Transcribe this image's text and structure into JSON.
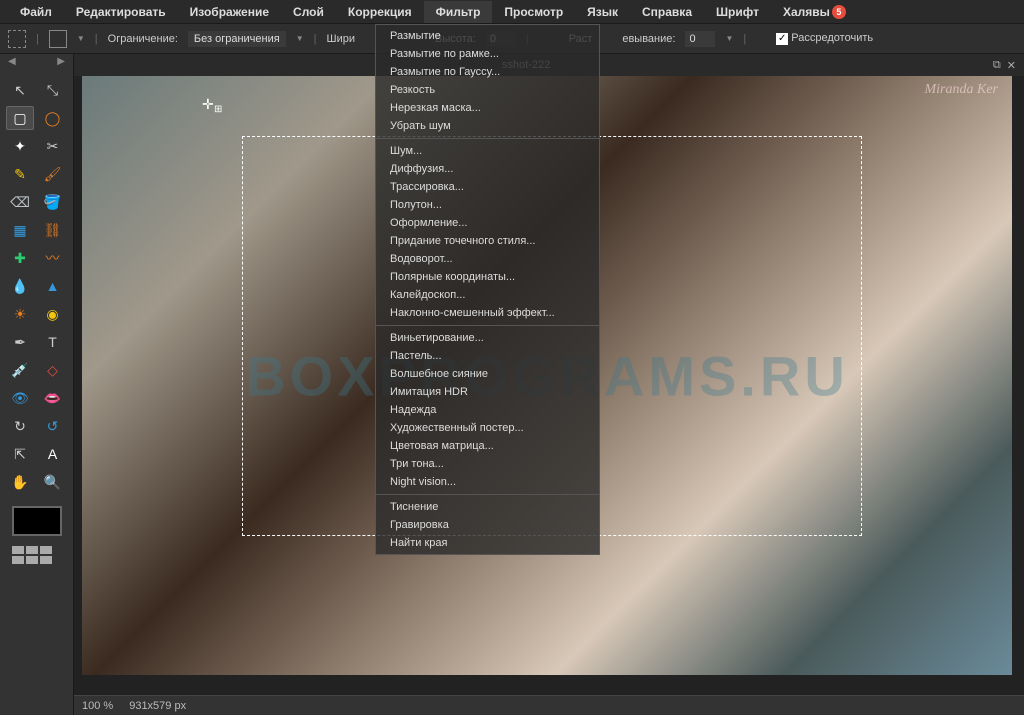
{
  "menubar": [
    "Файл",
    "Редактировать",
    "Изображение",
    "Слой",
    "Коррекция",
    "Фильтр",
    "Просмотр",
    "Язык",
    "Справка",
    "Шрифт",
    "Халявы"
  ],
  "menubar_badge": "5",
  "options": {
    "limit_label": "Ограничение:",
    "limit_value": "Без ограничения",
    "width_label": "Шири",
    "height_label": "Высота:",
    "height_value": "0",
    "feather_prefix": "Раст",
    "feather_label": "евывание:",
    "feather_value": "0",
    "disperse_label": "Рассредоточить"
  },
  "document": {
    "tab_title": "sshot-222",
    "signature": "Miranda Ker",
    "watermark": "BOXPROGRAMS.RU"
  },
  "filter_menu": {
    "groups": [
      [
        "Размытие",
        "Размытие по рамке...",
        "Размытие по Гауссу...",
        "Резкость",
        "Нерезкая маска...",
        "Убрать шум"
      ],
      [
        "Шум...",
        "Диффузия...",
        "Трассировка...",
        "Полутон...",
        "Оформление...",
        "Придание точечного стиля...",
        "Водоворот...",
        "Полярные координаты...",
        "Калейдоскоп...",
        "Наклонно-смешенный эффект..."
      ],
      [
        "Виньетирование...",
        "Пастель...",
        "Волшебное сияние",
        "Имитация HDR",
        "Надежда",
        "Художественный постер...",
        "Цветовая матрица...",
        "Три тона...",
        "Night vision..."
      ],
      [
        "Тиснение",
        "Гравировка",
        "Найти края"
      ]
    ]
  },
  "status": {
    "zoom": "100 %",
    "dimensions": "931x579 px"
  },
  "tools": [
    "move-tool",
    "transform-tool",
    "rect-select-tool",
    "lasso-tool",
    "wand-tool",
    "crop-tool",
    "pencil-tool",
    "brush-tool",
    "eraser-tool",
    "fill-tool",
    "gradient-tool",
    "stamp-tool",
    "heal-tool",
    "smudge-tool",
    "blur-tool",
    "sharpen-tool",
    "dodge-tool",
    "sponge-tool",
    "pen-tool",
    "type-tool",
    "color-picker-tool",
    "shape-tool",
    "red-eye-tool",
    "liquify-tool",
    "rotate-cw-tool",
    "rotate-ccw-tool",
    "pointer-tool",
    "text-tool",
    "hand-tool",
    "zoom-tool"
  ]
}
